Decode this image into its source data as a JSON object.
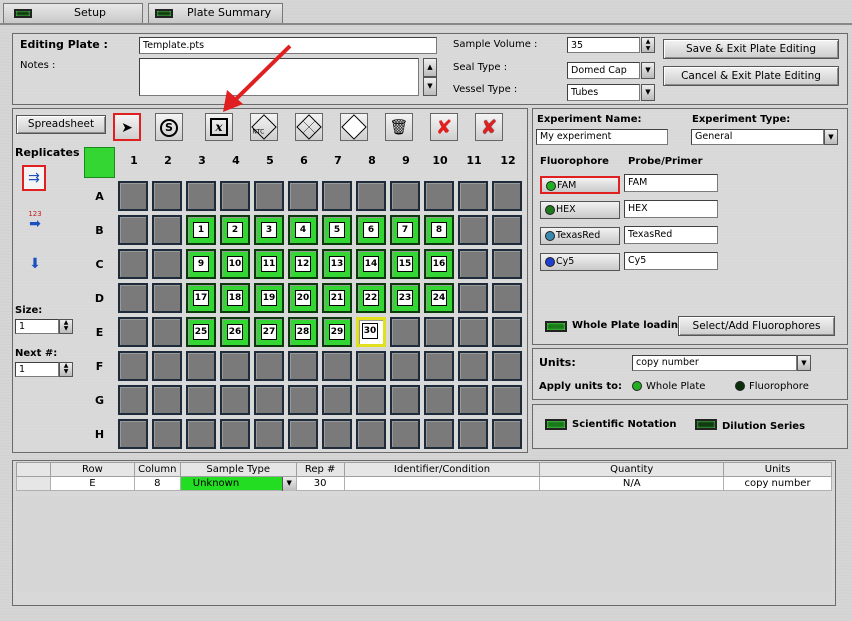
{
  "tabs": [
    {
      "label": "Setup"
    },
    {
      "label": "Plate Summary"
    }
  ],
  "editing": {
    "label": "Editing Plate :",
    "value": "Template.pts",
    "notes_label": "Notes :",
    "notes_value": ""
  },
  "settings": {
    "sample_volume_label": "Sample Volume :",
    "sample_volume": "35",
    "seal_type_label": "Seal Type :",
    "seal_type": "Domed Cap",
    "vessel_type_label": "Vessel Type :",
    "vessel_type": "Tubes"
  },
  "actions": {
    "save": "Save & Exit Plate Editing",
    "cancel": "Cancel & Exit Plate Editing"
  },
  "toolbar": {
    "spreadsheet": "Spreadsheet",
    "standard_glyph": "S",
    "unknown_glyph": "x",
    "ntc_glyph": "NTC"
  },
  "side": {
    "replicates": "Replicates",
    "ordinal_glyph": "123",
    "size_label": "Size:",
    "size_value": "1",
    "next_label": "Next #:",
    "next_value": "1"
  },
  "plate": {
    "columns": [
      "1",
      "2",
      "3",
      "4",
      "5",
      "6",
      "7",
      "8",
      "9",
      "10",
      "11",
      "12"
    ],
    "rows": [
      "A",
      "B",
      "C",
      "D",
      "E",
      "F",
      "G",
      "H"
    ],
    "wells": [
      {
        "row": "B",
        "col": 3,
        "num": "1"
      },
      {
        "row": "B",
        "col": 4,
        "num": "2"
      },
      {
        "row": "B",
        "col": 5,
        "num": "3"
      },
      {
        "row": "B",
        "col": 6,
        "num": "4"
      },
      {
        "row": "B",
        "col": 7,
        "num": "5"
      },
      {
        "row": "B",
        "col": 8,
        "num": "6"
      },
      {
        "row": "B",
        "col": 9,
        "num": "7"
      },
      {
        "row": "B",
        "col": 10,
        "num": "8"
      },
      {
        "row": "C",
        "col": 3,
        "num": "9"
      },
      {
        "row": "C",
        "col": 4,
        "num": "10"
      },
      {
        "row": "C",
        "col": 5,
        "num": "11"
      },
      {
        "row": "C",
        "col": 6,
        "num": "12"
      },
      {
        "row": "C",
        "col": 7,
        "num": "13"
      },
      {
        "row": "C",
        "col": 8,
        "num": "14"
      },
      {
        "row": "C",
        "col": 9,
        "num": "15"
      },
      {
        "row": "C",
        "col": 10,
        "num": "16"
      },
      {
        "row": "D",
        "col": 3,
        "num": "17"
      },
      {
        "row": "D",
        "col": 4,
        "num": "18"
      },
      {
        "row": "D",
        "col": 5,
        "num": "19"
      },
      {
        "row": "D",
        "col": 6,
        "num": "20"
      },
      {
        "row": "D",
        "col": 7,
        "num": "21"
      },
      {
        "row": "D",
        "col": 8,
        "num": "22"
      },
      {
        "row": "D",
        "col": 9,
        "num": "23"
      },
      {
        "row": "D",
        "col": 10,
        "num": "24"
      },
      {
        "row": "E",
        "col": 3,
        "num": "25"
      },
      {
        "row": "E",
        "col": 4,
        "num": "26"
      },
      {
        "row": "E",
        "col": 5,
        "num": "27"
      },
      {
        "row": "E",
        "col": 6,
        "num": "28"
      },
      {
        "row": "E",
        "col": 7,
        "num": "29"
      },
      {
        "row": "E",
        "col": 8,
        "num": "30",
        "selected": true
      }
    ]
  },
  "experiment": {
    "name_label": "Experiment Name:",
    "name_value": "My experiment",
    "type_label": "Experiment Type:",
    "type_value": "General",
    "fluor_header": "Fluorophore",
    "probe_header": "Probe/Primer",
    "fluorophores": [
      {
        "name": "FAM",
        "probe": "FAM",
        "color": "#22b022"
      },
      {
        "name": "HEX",
        "probe": "HEX",
        "color": "#1c7a1c"
      },
      {
        "name": "TexasRed",
        "probe": "TexasRed",
        "color": "#3a8ab0"
      },
      {
        "name": "Cy5",
        "probe": "Cy5",
        "color": "#1f3fd0"
      }
    ],
    "whole_plate_loading": "Whole Plate loading",
    "select_fluor": "Select/Add Fluorophores"
  },
  "units": {
    "label": "Units:",
    "value": "copy number",
    "apply_label": "Apply units to:",
    "opt_whole": "Whole Plate",
    "opt_fluor": "Fluorophore"
  },
  "notation": {
    "scientific": "Scientific Notation",
    "dilution": "Dilution Series"
  },
  "table": {
    "headers": [
      "",
      "Row",
      "Column",
      "Sample Type",
      "Rep #",
      "Identifier/Condition",
      "Quantity",
      "Units"
    ],
    "row": {
      "row": "E",
      "column": "8",
      "sample_type": "Unknown",
      "rep": "30",
      "identifier": "",
      "quantity": "N/A",
      "units": "copy number"
    }
  },
  "colors": {
    "accent_green": "#33d633",
    "arrow_red": "#e02020",
    "unknown_green": "#22dd22"
  }
}
